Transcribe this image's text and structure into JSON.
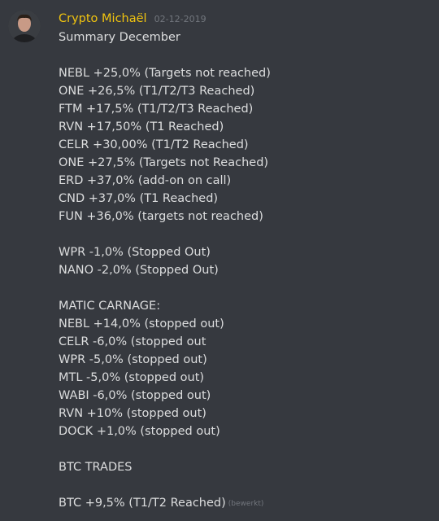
{
  "message": {
    "author": "Crypto Michaël",
    "timestamp": "02-12-2019",
    "edited_label": "(bewerkt)",
    "username_color": "#f1c40f",
    "lines": [
      "Summary December",
      "",
      "NEBL +25,0% (Targets not reached)",
      "ONE +26,5% (T1/T2/T3 Reached)",
      "FTM +17,5% (T1/T2/T3 Reached)",
      "RVN +17,50% (T1 Reached)",
      "CELR +30,00% (T1/T2 Reached)",
      "ONE +27,5% (Targets not Reached)",
      "ERD +37,0% (add-on on call)",
      "CND +37,0% (T1 Reached)",
      "FUN +36,0% (targets not reached)",
      "",
      "WPR -1,0% (Stopped Out)",
      "NANO -2,0% (Stopped Out)",
      "",
      "MATIC CARNAGE:",
      "NEBL +14,0% (stopped out)",
      "CELR -6,0% (stopped out",
      "WPR -5,0% (stopped out)",
      "MTL -5,0% (stopped out)",
      "WABI -6,0% (stopped out)",
      "RVN +10% (stopped out)",
      "DOCK +1,0% (stopped out)",
      "",
      "BTC TRADES",
      "",
      "BTC +9,5% (T1/T2 Reached)"
    ]
  }
}
